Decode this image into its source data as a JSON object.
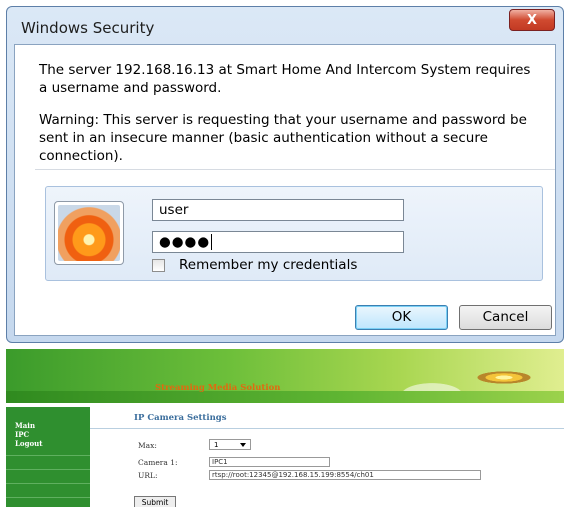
{
  "dialog": {
    "title": "Windows Security",
    "close_symbol": "X",
    "message": "The server 192.168.16.13 at Smart Home And Intercom System requires a username and password.",
    "warning": "Warning: This server is requesting that your username and password be sent in an insecure manner (basic authentication without a secure connection).",
    "username_value": "user",
    "password_mask": "●●●●",
    "remember_label": "Remember my credentials",
    "ok_label": "OK",
    "cancel_label": "Cancel",
    "avatar_icon": "flower-user-icon"
  },
  "web": {
    "banner_title": "Streaming Media Solution",
    "nav": [
      "Main",
      "IPC",
      "Logout"
    ],
    "section_title": "IP Camera Settings",
    "max_label": "Max:",
    "max_value": "1",
    "camera_label": "Camera 1:",
    "camera_value": "IPC1",
    "url_label": "URL:",
    "url_value": "rtsp://root:12345@192.168.15.199:8554/ch01",
    "submit_label": "Submit"
  },
  "colors": {
    "title_bar": "#c5d8ee",
    "close_button": "#c94a32",
    "ok_button_border": "#3c7fb1",
    "banner_green": "#3b9b2b",
    "sidebar_green": "#2f8f2f",
    "banner_title_orange": "#e06a10",
    "section_title_blue": "#3a6d9c"
  }
}
